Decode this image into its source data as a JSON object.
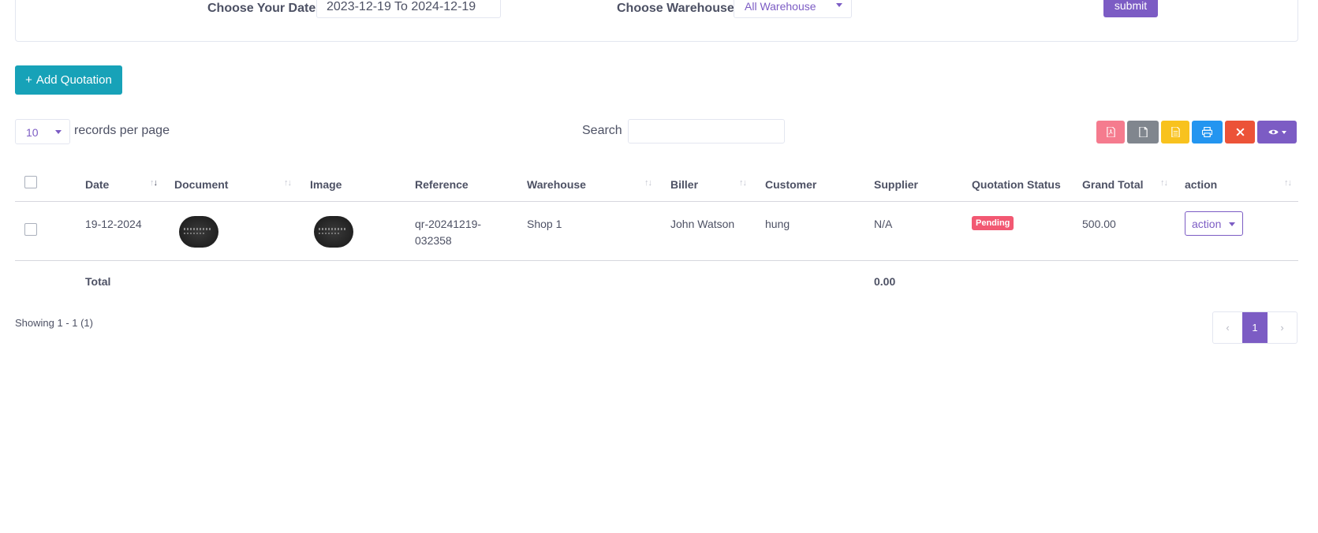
{
  "filter": {
    "date_label": "Choose Your Date",
    "date_value": "2023-12-19 To 2024-12-19",
    "warehouse_label": "Choose Warehouse",
    "warehouse_value": "All Warehouse",
    "submit_label": "submit"
  },
  "add_button": {
    "icon": "+",
    "label": "Add Quotation"
  },
  "per_page": {
    "value": "10",
    "label": "records per page"
  },
  "search": {
    "label": "Search",
    "value": ""
  },
  "toolbar": {
    "buttons": [
      "pdf-icon",
      "csv-icon",
      "excel-icon",
      "print-icon",
      "delete-icon",
      "eye-icon"
    ],
    "colors": {
      "pdf": "#f57b8e",
      "csv": "#80868e",
      "excel": "#f8c21e",
      "print": "#2395f0",
      "delete": "#ec5338",
      "visibility": "#7c5cc4"
    }
  },
  "table": {
    "headers": {
      "date": "Date",
      "document": "Document",
      "image": "Image",
      "reference": "Reference",
      "warehouse": "Warehouse",
      "biller": "Biller",
      "customer": "Customer",
      "supplier": "Supplier",
      "status": "Quotation Status",
      "grand_total": "Grand Total",
      "action": "action"
    },
    "rows": [
      {
        "date": "19-12-2024",
        "reference_line1": "qr-20241219-",
        "reference_line2": "032358",
        "warehouse": "Shop 1",
        "biller": "John Watson",
        "customer": "hung",
        "supplier": "N/A",
        "status": "Pending",
        "grand_total": "500.00",
        "action": "action"
      }
    ],
    "footer": {
      "label": "Total",
      "total": "0.00"
    }
  },
  "showing": "Showing 1 - 1 (1)",
  "pagination": {
    "prev": "‹",
    "current": "1",
    "next": "›"
  },
  "colors": {
    "primary": "#7c5cc4",
    "info": "#17a2b8",
    "danger_badge": "#f25872"
  }
}
